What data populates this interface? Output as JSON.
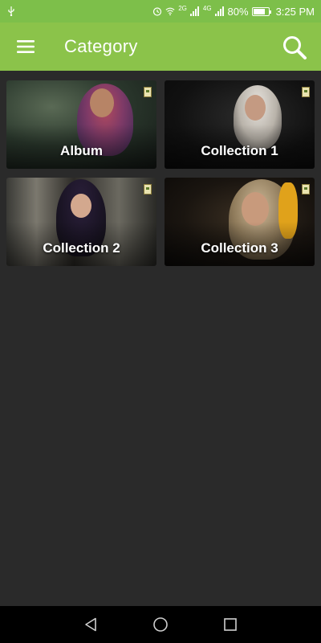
{
  "status_bar": {
    "battery_percent": "80%",
    "time": "3:25 PM",
    "battery_level": 0.8,
    "network_labels": [
      "2G",
      "4G"
    ]
  },
  "app_bar": {
    "title": "Category",
    "background_color": "#8bc34a",
    "menu_icon": "hamburger-menu-icon",
    "search_icon": "search-icon"
  },
  "categories": [
    {
      "label": "Album"
    },
    {
      "label": "Collection 1"
    },
    {
      "label": "Collection 2"
    },
    {
      "label": "Collection 3"
    }
  ],
  "nav_bar": {
    "back_icon": "back-triangle-icon",
    "home_icon": "home-circle-icon",
    "recents_icon": "recents-square-icon"
  }
}
